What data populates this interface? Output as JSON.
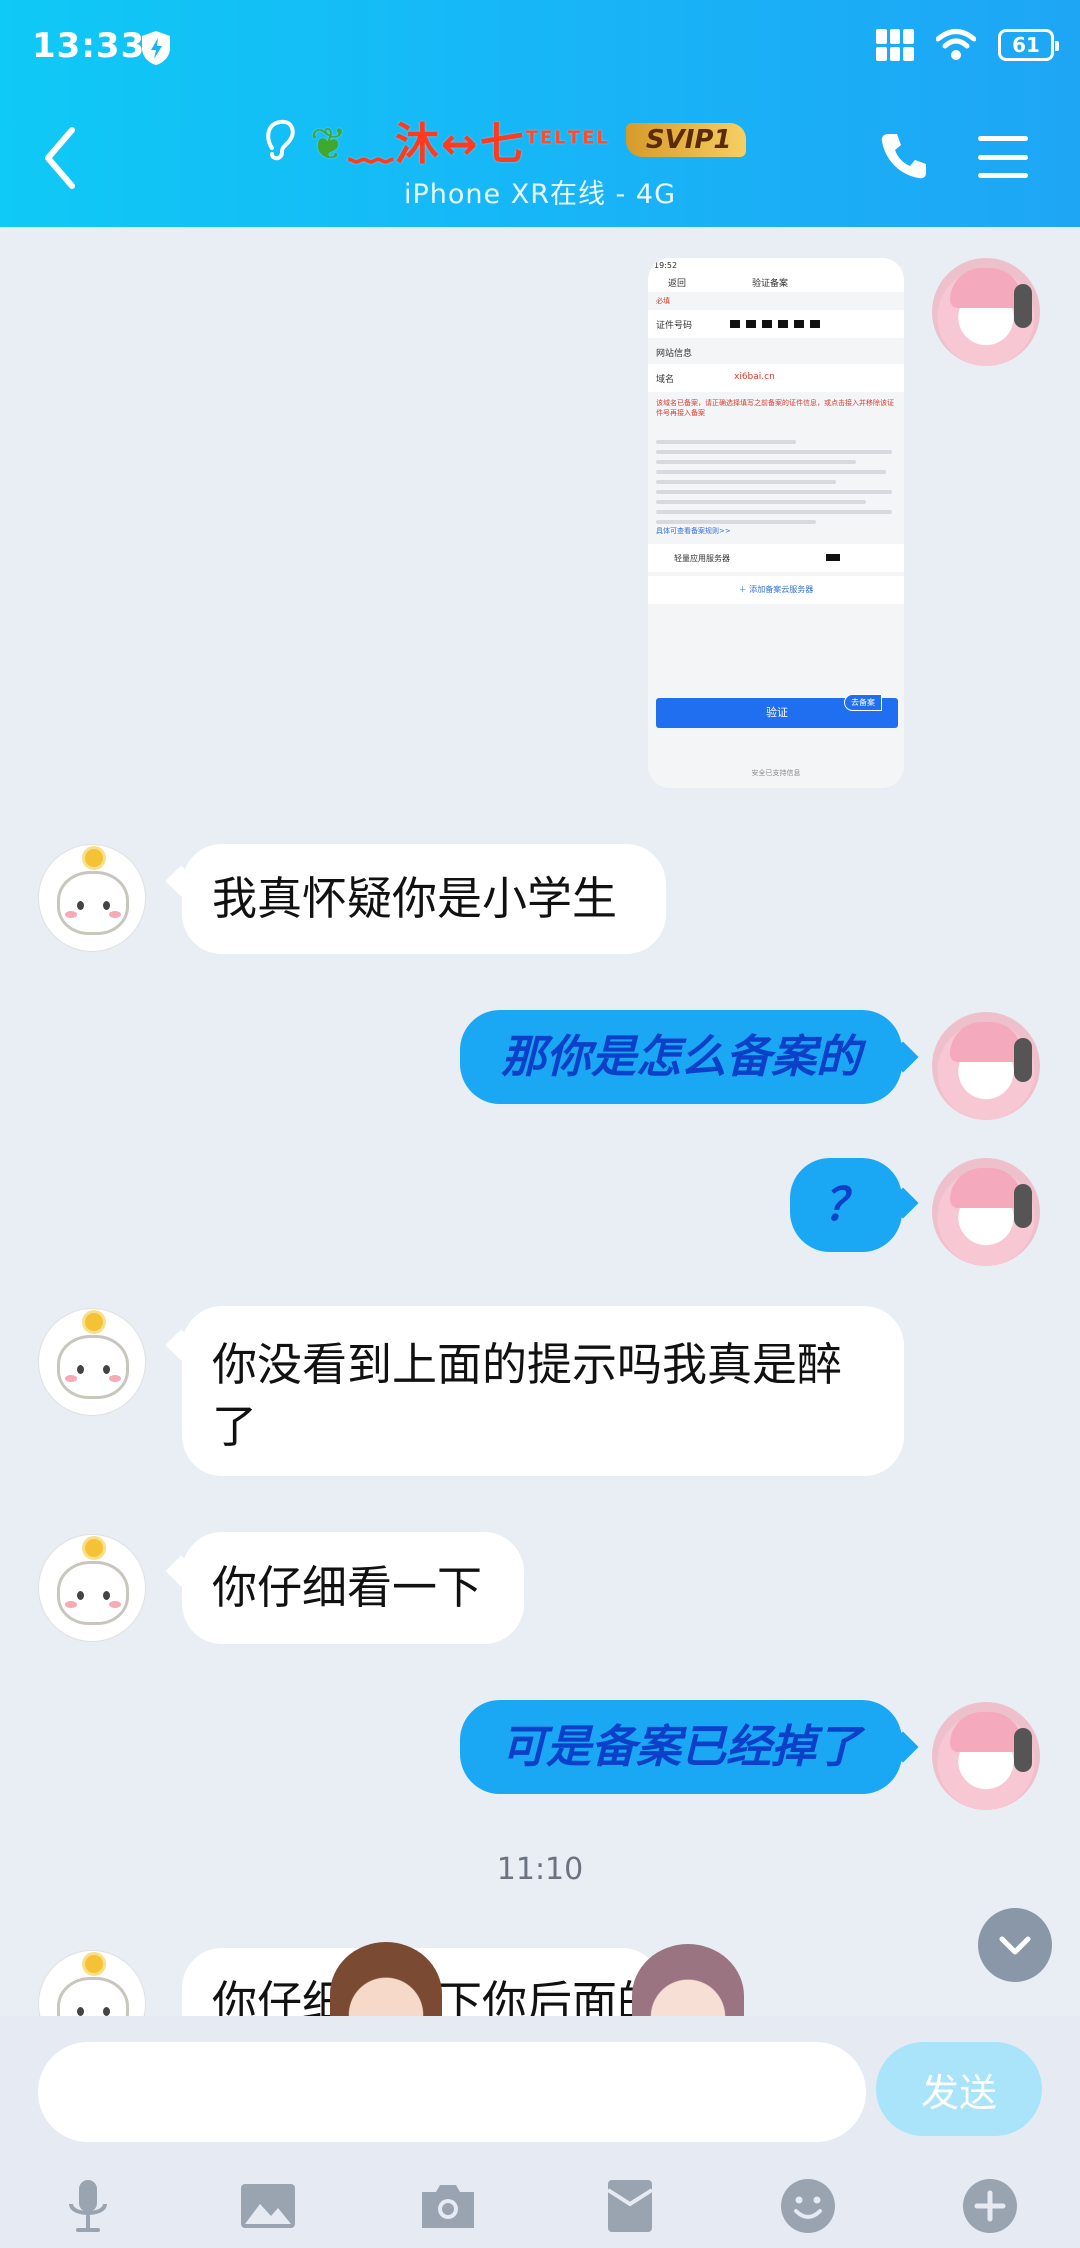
{
  "status_bar": {
    "time": "13:33",
    "battery": "61"
  },
  "header": {
    "nickname_prefix": "ℹ︎",
    "nickname": "﹏沐↔七",
    "nickname_tel_1": "TEL",
    "nickname_tel_2": "TEL",
    "svip": "SVIP1",
    "subtitle": "iPhone XR在线 - 4G"
  },
  "screenshot_image": {
    "time": "19:52",
    "back": "返回",
    "title": "验证备案",
    "required": "必填",
    "id_label": "证件号码",
    "site_info": "网站信息",
    "domain_label": "域名",
    "domain_value": "xi6bai.cn",
    "warning": "该域名已备案，请正确选择填写之前备案的证件信息，或点击接入并移除该证件号再接入备案",
    "link": "具体可查看备案规则>>",
    "server_label": "轻量应用服务器",
    "add_server": "＋ 添加备案云服务器",
    "verify_button": "验证",
    "badge": "去备案",
    "footer": "安全已支持信息"
  },
  "messages": [
    {
      "side": "left",
      "text": "我真怀疑你是小学生"
    },
    {
      "side": "right",
      "text": "那你是怎么备案的"
    },
    {
      "side": "right",
      "text": "？"
    },
    {
      "side": "left",
      "text": "你没看到上面的提示吗我真是醉了"
    },
    {
      "side": "left",
      "text": "你仔细看一下"
    },
    {
      "side": "right",
      "text": "可是备案已经掉了"
    },
    {
      "side": "left",
      "text": "你仔细看一下你后面的"
    }
  ],
  "time_separator": "11:10",
  "input": {
    "value": "",
    "send_label": "发送"
  },
  "icons": [
    "shield-icon",
    "grid-signal-icon",
    "wifi-icon",
    "battery-icon",
    "back-arrow-icon",
    "ear-icon",
    "phone-icon",
    "menu-icon",
    "chevron-down-icon",
    "microphone-icon",
    "image-icon",
    "camera-icon",
    "red-packet-icon",
    "emoji-icon",
    "plus-icon"
  ]
}
